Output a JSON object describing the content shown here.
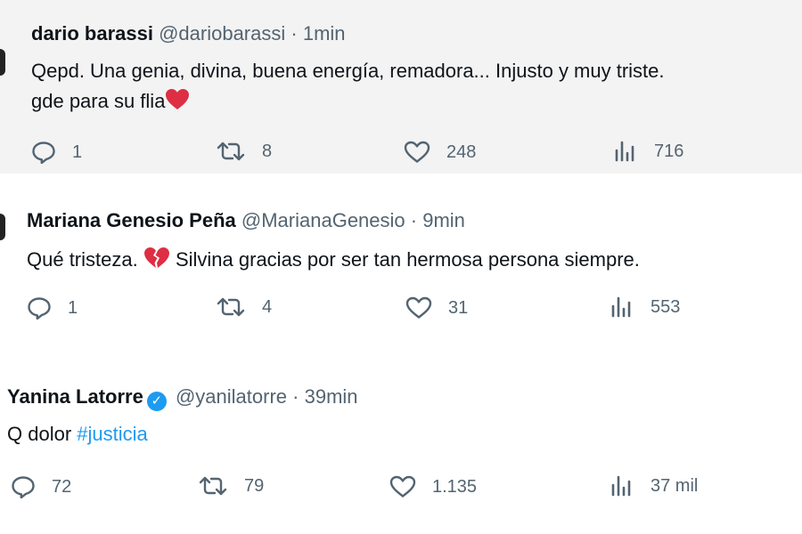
{
  "colors": {
    "accent": "#1d9bf0",
    "secondary_text": "#536471",
    "emoji_red": "#dd2e44"
  },
  "tweets": [
    {
      "name": "dario barassi",
      "handle": "@dariobarassi",
      "separator": "·",
      "time": "1min",
      "verified": false,
      "line1": "Qepd. Una genia, divina, buena energía, remadora... Injusto y muy triste.",
      "line2": "gde para su flia",
      "emoji": "red-heart",
      "replies": "1",
      "retweets": "8",
      "likes": "248",
      "views": "716"
    },
    {
      "name": "Mariana Genesio Peña",
      "handle": "@MarianaGenesio",
      "separator": "·",
      "time": "9min",
      "verified": false,
      "line1_before": "Qué tristeza.",
      "emoji": "broken-heart",
      "line1_after": "Silvina gracias por ser tan hermosa persona siempre.",
      "replies": "1",
      "retweets": "4",
      "likes": "31",
      "views": "553"
    },
    {
      "name": "Yanina Latorre",
      "handle": "@yanilatorre",
      "separator": "·",
      "time": "39min",
      "verified": true,
      "verified_glyph": "✓",
      "text_before": "Q dolor",
      "hashtag": "#justicia",
      "replies": "72",
      "retweets": "79",
      "likes": "1.135",
      "views": "37 mil"
    }
  ]
}
